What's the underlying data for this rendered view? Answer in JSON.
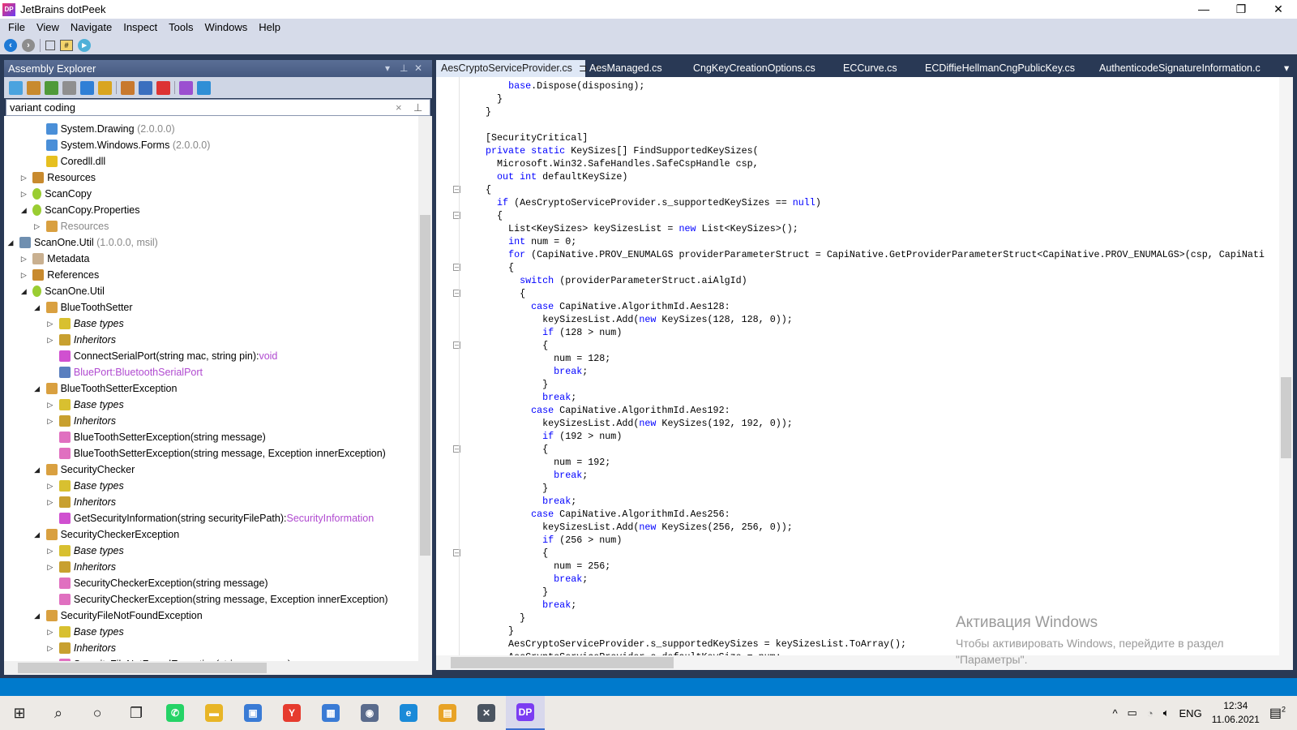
{
  "window": {
    "title": "JetBrains dotPeek",
    "logo": "DP",
    "minimize": "—",
    "maximize": "❐",
    "close": "✕"
  },
  "menu": [
    "File",
    "View",
    "Navigate",
    "Inspect",
    "Tools",
    "Windows",
    "Help"
  ],
  "toolbar": {
    "icons": [
      "back-icon",
      "forward-icon",
      "chip-icon",
      "csharp-tag-icon",
      "run-icon"
    ]
  },
  "assembly_explorer": {
    "title": "Assembly Explorer",
    "dropdown": "▾",
    "pin": "⊥",
    "close": "✕",
    "toolbar_icons": [
      "open-from-gac-icon",
      "open-folder-icon",
      "add-assembly-list-icon",
      "assembly-list-icon",
      "add-nuget-icon",
      "add-settings-icon",
      "export-project-icon",
      "save-assembly-list-icon",
      "remove-icon",
      "open-vs-icon",
      "pdb-icon"
    ],
    "toolbar_colors": [
      "#4aa3df",
      "#c88a2e",
      "#4f9a3a",
      "#8f8f8f",
      "#2f7fd6",
      "#d9a520",
      "#c8792e",
      "#3b6fbf",
      "#d33",
      "#9b4fd0",
      "#2f8fd6"
    ],
    "search_value": "variant coding",
    "search_clear": "×",
    "search_pin": "⊥",
    "tree": [
      {
        "level": 2,
        "exp": "none",
        "icon": "reference",
        "text": "System.Drawing",
        "suffix": " (2.0.0.0)",
        "style": "normal",
        "suffix_style": "gray"
      },
      {
        "level": 2,
        "exp": "none",
        "icon": "reference",
        "text": "System.Windows.Forms",
        "suffix": " (2.0.0.0)",
        "style": "normal",
        "suffix_style": "gray"
      },
      {
        "level": 2,
        "exp": "none",
        "icon": "unresolved-reference",
        "text": "Coredll.dll",
        "suffix": "",
        "style": "normal"
      },
      {
        "level": 1,
        "exp": "collapsed",
        "icon": "resources-folder",
        "text": "Resources",
        "suffix": "",
        "style": "normal"
      },
      {
        "level": 1,
        "exp": "collapsed",
        "icon": "namespace",
        "text": "ScanCopy",
        "suffix": "",
        "style": "normal"
      },
      {
        "level": 1,
        "exp": "expanded",
        "icon": "namespace",
        "text": "ScanCopy.Properties",
        "suffix": "",
        "style": "normal"
      },
      {
        "level": 2,
        "exp": "collapsed",
        "icon": "class",
        "text": "Resources",
        "suffix": "",
        "style": "gray"
      },
      {
        "level": 0,
        "exp": "expanded",
        "icon": "assembly",
        "text": "ScanOne.Util",
        "suffix": " (1.0.0.0, msil)",
        "style": "normal",
        "suffix_style": "gray"
      },
      {
        "level": 1,
        "exp": "collapsed",
        "icon": "metadata-tag",
        "text": "Metadata",
        "suffix": "",
        "style": "normal"
      },
      {
        "level": 1,
        "exp": "collapsed",
        "icon": "references-folder",
        "text": "References",
        "suffix": "",
        "style": "normal"
      },
      {
        "level": 1,
        "exp": "expanded",
        "icon": "namespace",
        "text": "ScanOne.Util",
        "suffix": "",
        "style": "normal"
      },
      {
        "level": 2,
        "exp": "expanded",
        "icon": "class",
        "text": "BlueToothSetter",
        "suffix": "",
        "style": "normal"
      },
      {
        "level": 3,
        "exp": "collapsed",
        "icon": "base-types",
        "text": "Base types",
        "suffix": "",
        "style": "italic"
      },
      {
        "level": 3,
        "exp": "collapsed",
        "icon": "inheritors",
        "text": "Inheritors",
        "suffix": "",
        "style": "italic"
      },
      {
        "level": 3,
        "exp": "none",
        "icon": "method",
        "text": "ConnectSerialPort(string mac, string pin):",
        "suffix": "void",
        "style": "normal",
        "suffix_style": "purple"
      },
      {
        "level": 3,
        "exp": "none",
        "icon": "property",
        "text": "BluePort:BluetoothSerialPort",
        "suffix": "",
        "style": "purple"
      },
      {
        "level": 2,
        "exp": "expanded",
        "icon": "class",
        "text": "BlueToothSetterException",
        "suffix": "",
        "style": "normal"
      },
      {
        "level": 3,
        "exp": "collapsed",
        "icon": "base-types",
        "text": "Base types",
        "suffix": "",
        "style": "italic"
      },
      {
        "level": 3,
        "exp": "collapsed",
        "icon": "inheritors",
        "text": "Inheritors",
        "suffix": "",
        "style": "italic"
      },
      {
        "level": 3,
        "exp": "none",
        "icon": "constructor",
        "text": "BlueToothSetterException(string message)",
        "suffix": "",
        "style": "normal"
      },
      {
        "level": 3,
        "exp": "none",
        "icon": "constructor",
        "text": "BlueToothSetterException(string message, Exception innerException)",
        "suffix": "",
        "style": "normal"
      },
      {
        "level": 2,
        "exp": "expanded",
        "icon": "class",
        "text": "SecurityChecker",
        "suffix": "",
        "style": "normal"
      },
      {
        "level": 3,
        "exp": "collapsed",
        "icon": "base-types",
        "text": "Base types",
        "suffix": "",
        "style": "italic"
      },
      {
        "level": 3,
        "exp": "collapsed",
        "icon": "inheritors",
        "text": "Inheritors",
        "suffix": "",
        "style": "italic"
      },
      {
        "level": 3,
        "exp": "none",
        "icon": "method",
        "text": "GetSecurityInformation(string securityFilePath):",
        "suffix": "SecurityInformation",
        "style": "normal",
        "suffix_style": "purple"
      },
      {
        "level": 2,
        "exp": "expanded",
        "icon": "class",
        "text": "SecurityCheckerException",
        "suffix": "",
        "style": "normal"
      },
      {
        "level": 3,
        "exp": "collapsed",
        "icon": "base-types",
        "text": "Base types",
        "suffix": "",
        "style": "italic"
      },
      {
        "level": 3,
        "exp": "collapsed",
        "icon": "inheritors",
        "text": "Inheritors",
        "suffix": "",
        "style": "italic"
      },
      {
        "level": 3,
        "exp": "none",
        "icon": "constructor",
        "text": "SecurityCheckerException(string message)",
        "suffix": "",
        "style": "normal"
      },
      {
        "level": 3,
        "exp": "none",
        "icon": "constructor",
        "text": "SecurityCheckerException(string message, Exception innerException)",
        "suffix": "",
        "style": "normal"
      },
      {
        "level": 2,
        "exp": "expanded",
        "icon": "class",
        "text": "SecurityFileNotFoundException",
        "suffix": "",
        "style": "normal"
      },
      {
        "level": 3,
        "exp": "collapsed",
        "icon": "base-types",
        "text": "Base types",
        "suffix": "",
        "style": "italic"
      },
      {
        "level": 3,
        "exp": "collapsed",
        "icon": "inheritors",
        "text": "Inheritors",
        "suffix": "",
        "style": "italic"
      },
      {
        "level": 3,
        "exp": "none",
        "icon": "constructor",
        "text": "SecurityFileNotFoundException(string message)",
        "suffix": "",
        "style": "normal"
      }
    ]
  },
  "editor": {
    "tabs": [
      {
        "label": "AesCryptoServiceProvider.cs",
        "active": true,
        "pin": "⊐",
        "close": "✕"
      },
      {
        "label": "AesManaged.cs"
      },
      {
        "label": "CngKeyCreationOptions.cs"
      },
      {
        "label": "ECCurve.cs"
      },
      {
        "label": "ECDiffieHellmanCngPublicKey.cs"
      },
      {
        "label": "AuthenticodeSignatureInformation.c"
      }
    ],
    "tab_overflow": "▾",
    "fold_lines": [
      9,
      11,
      15,
      17,
      21,
      29,
      37
    ],
    "lines": [
      [
        [
          "    "
        ],
        [
          "base",
          "kw"
        ],
        [
          ".Dispose(disposing);"
        ]
      ],
      [
        [
          "  }"
        ]
      ],
      [
        [
          "}"
        ]
      ],
      [
        [
          ""
        ]
      ],
      [
        [
          "[SecurityCritical]"
        ]
      ],
      [
        [
          "private static",
          "kw"
        ],
        [
          " KeySizes[] FindSupportedKeySizes("
        ]
      ],
      [
        [
          "  Microsoft.Win32.SafeHandles.SafeCspHandle csp,"
        ]
      ],
      [
        [
          "  "
        ],
        [
          "out int",
          "kw"
        ],
        [
          " defaultKeySize)"
        ]
      ],
      [
        [
          "{"
        ]
      ],
      [
        [
          "  "
        ],
        [
          "if",
          "kw"
        ],
        [
          " (AesCryptoServiceProvider.s_supportedKeySizes == "
        ],
        [
          "null",
          "kw"
        ],
        [
          ")"
        ]
      ],
      [
        [
          "  {"
        ]
      ],
      [
        [
          "    List<KeySizes> keySizesList = "
        ],
        [
          "new",
          "kw"
        ],
        [
          " List<KeySizes>();"
        ]
      ],
      [
        [
          "    "
        ],
        [
          "int",
          "kw"
        ],
        [
          " num = 0;"
        ]
      ],
      [
        [
          "    "
        ],
        [
          "for",
          "kw"
        ],
        [
          " (CapiNative.PROV_ENUMALGS providerParameterStruct = CapiNative.GetProviderParameterStruct<CapiNative.PROV_ENUMALGS>(csp, CapiNati"
        ]
      ],
      [
        [
          "    {"
        ]
      ],
      [
        [
          "      "
        ],
        [
          "switch",
          "kw"
        ],
        [
          " (providerParameterStruct.aiAlgId)"
        ]
      ],
      [
        [
          "      {"
        ]
      ],
      [
        [
          "        "
        ],
        [
          "case",
          "kw"
        ],
        [
          " CapiNative.AlgorithmId.Aes128:"
        ]
      ],
      [
        [
          "          keySizesList.Add("
        ],
        [
          "new",
          "kw"
        ],
        [
          " KeySizes(128, 128, 0));"
        ]
      ],
      [
        [
          "          "
        ],
        [
          "if",
          "kw"
        ],
        [
          " (128 > num)"
        ]
      ],
      [
        [
          "          {"
        ]
      ],
      [
        [
          "            num = 128;"
        ]
      ],
      [
        [
          "            "
        ],
        [
          "break",
          "kw"
        ],
        [
          ";"
        ]
      ],
      [
        [
          "          }"
        ]
      ],
      [
        [
          "          "
        ],
        [
          "break",
          "kw"
        ],
        [
          ";"
        ]
      ],
      [
        [
          "        "
        ],
        [
          "case",
          "kw"
        ],
        [
          " CapiNative.AlgorithmId.Aes192:"
        ]
      ],
      [
        [
          "          keySizesList.Add("
        ],
        [
          "new",
          "kw"
        ],
        [
          " KeySizes(192, 192, 0));"
        ]
      ],
      [
        [
          "          "
        ],
        [
          "if",
          "kw"
        ],
        [
          " (192 > num)"
        ]
      ],
      [
        [
          "          {"
        ]
      ],
      [
        [
          "            num = 192;"
        ]
      ],
      [
        [
          "            "
        ],
        [
          "break",
          "kw"
        ],
        [
          ";"
        ]
      ],
      [
        [
          "          }"
        ]
      ],
      [
        [
          "          "
        ],
        [
          "break",
          "kw"
        ],
        [
          ";"
        ]
      ],
      [
        [
          "        "
        ],
        [
          "case",
          "kw"
        ],
        [
          " CapiNative.AlgorithmId.Aes256:"
        ]
      ],
      [
        [
          "          keySizesList.Add("
        ],
        [
          "new",
          "kw"
        ],
        [
          " KeySizes(256, 256, 0));"
        ]
      ],
      [
        [
          "          "
        ],
        [
          "if",
          "kw"
        ],
        [
          " (256 > num)"
        ]
      ],
      [
        [
          "          {"
        ]
      ],
      [
        [
          "            num = 256;"
        ]
      ],
      [
        [
          "            "
        ],
        [
          "break",
          "kw"
        ],
        [
          ";"
        ]
      ],
      [
        [
          "          }"
        ]
      ],
      [
        [
          "          "
        ],
        [
          "break",
          "kw"
        ],
        [
          ";"
        ]
      ],
      [
        [
          "      }"
        ]
      ],
      [
        [
          "    }"
        ]
      ],
      [
        [
          "    AesCryptoServiceProvider.s_supportedKeySizes = keySizesList.ToArray();"
        ]
      ],
      [
        [
          "    AesCryptoServiceProvider.s_defaultKeySize = num;"
        ]
      ]
    ]
  },
  "watermark": {
    "title": "Активация Windows",
    "text": "Чтобы активировать Windows, перейдите в раздел \"Параметры\"."
  },
  "taskbar": {
    "apps": [
      {
        "name": "start",
        "glyph": "⊞",
        "color": "#222"
      },
      {
        "name": "search",
        "glyph": "⌕",
        "color": "#222"
      },
      {
        "name": "cortana",
        "glyph": "○",
        "color": "#222"
      },
      {
        "name": "task-view",
        "glyph": "❐",
        "color": "#222"
      },
      {
        "name": "whatsapp",
        "glyph": "✆",
        "color": "#25d366"
      },
      {
        "name": "file-explorer",
        "glyph": "▬",
        "color": "#e8b526"
      },
      {
        "name": "app",
        "glyph": "▣",
        "color": "#3a7bd5"
      },
      {
        "name": "yandex-browser",
        "glyph": "Y",
        "color": "#e63b2e"
      },
      {
        "name": "calculator",
        "glyph": "▦",
        "color": "#3a7bd5"
      },
      {
        "name": "app2",
        "glyph": "◉",
        "color": "#5a6b8c"
      },
      {
        "name": "edge",
        "glyph": "e",
        "color": "#1a8ad8"
      },
      {
        "name": "chat",
        "glyph": "▤",
        "color": "#e8a326"
      },
      {
        "name": "x-app",
        "glyph": "✕",
        "color": "#4a5460"
      },
      {
        "name": "dotpeek",
        "glyph": "DP",
        "color": "#7b3df2",
        "active": true
      }
    ],
    "tray": {
      "chevron": "^",
      "lang": "ENG",
      "time": "12:34",
      "date": "11.06.2021",
      "notifications": "2"
    }
  }
}
